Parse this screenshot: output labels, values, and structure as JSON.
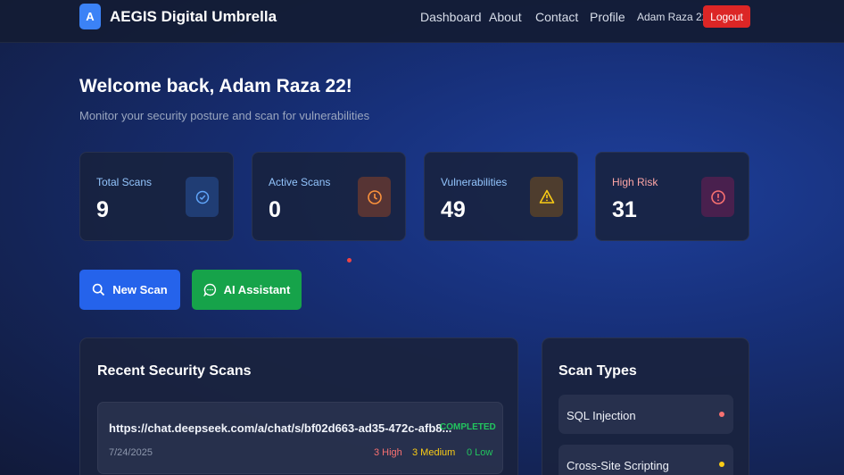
{
  "header": {
    "logo_letter": "A",
    "brand": "AEGIS Digital Umbrella",
    "nav": [
      "Dashboard",
      "About",
      "Contact",
      "Profile"
    ],
    "user": "Adam Raza 22",
    "logout": "Logout"
  },
  "welcome": {
    "title": "Welcome back, Adam Raza 22!",
    "subtitle": "Monitor your security posture and scan for vulnerabilities"
  },
  "stats": [
    {
      "label": "Total Scans",
      "value": "9",
      "icon": "shield-check-icon",
      "color": "#93c5fd"
    },
    {
      "label": "Active Scans",
      "value": "0",
      "icon": "clock-icon",
      "color": "#93c5fd"
    },
    {
      "label": "Vulnerabilities",
      "value": "49",
      "icon": "warning-icon",
      "color": "#93c5fd"
    },
    {
      "label": "High Risk",
      "value": "31",
      "icon": "alert-circle-icon",
      "color": "#fca5a5"
    }
  ],
  "actions": {
    "new_scan": "New Scan",
    "ai_assistant": "AI Assistant"
  },
  "recent": {
    "title": "Recent Security Scans",
    "scans": [
      {
        "url": "https://chat.deepseek.com/a/chat/s/bf02d663-ad35-472c-afb8...",
        "status": "COMPLETED",
        "date": "7/24/2025",
        "high": "3 High",
        "medium": "3 Medium",
        "low": "0 Low"
      }
    ]
  },
  "scan_types": {
    "title": "Scan Types",
    "items": [
      {
        "label": "SQL Injection",
        "dot_color": "#f87171"
      },
      {
        "label": "Cross-Site Scripting",
        "dot_color": "#facc15"
      }
    ]
  },
  "colors": {
    "primary": "#2563eb",
    "success": "#16a34a",
    "danger": "#dc2626",
    "high": "#f87171",
    "medium": "#facc15",
    "low": "#22c55e"
  }
}
